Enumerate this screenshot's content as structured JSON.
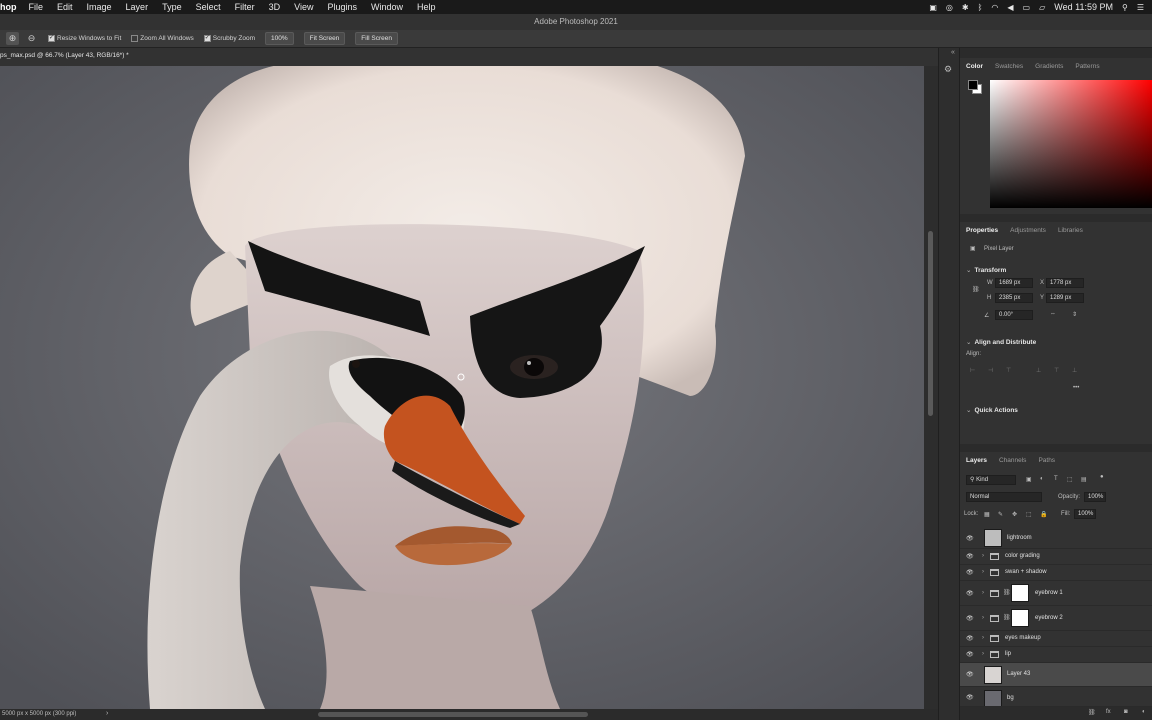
{
  "menubar": {
    "app": "hop",
    "items": [
      "File",
      "Edit",
      "Image",
      "Layer",
      "Type",
      "Select",
      "Filter",
      "3D",
      "View",
      "Plugins",
      "Window",
      "Help"
    ],
    "clock": "Wed 11:59 PM"
  },
  "titlebar": {
    "title": "Adobe Photoshop 2021"
  },
  "options": {
    "resize_windows": "Resize Windows to Fit",
    "zoom_all": "Zoom All Windows",
    "scrubby": "Scrubby Zoom",
    "zoom_pct": "100%",
    "fit_screen": "Fit Screen",
    "fill_screen": "Fill Screen"
  },
  "document": {
    "tab": "ps_max.psd @ 66.7% (Layer 43, RGB/16*) *"
  },
  "status": {
    "text": "5000 px x 5000 px (300 ppi)",
    "arrow": "›"
  },
  "color_panel": {
    "tabs": [
      "Color",
      "Swatches",
      "Gradients",
      "Patterns"
    ],
    "foreground": "#000000",
    "background": "#ffffff",
    "hue": "#ff0000"
  },
  "properties_panel": {
    "tabs": [
      "Properties",
      "Adjustments",
      "Libraries"
    ],
    "kind": "Pixel Layer",
    "transform": "Transform",
    "w_label": "W",
    "w": "1689 px",
    "x_label": "X",
    "x": "1778 px",
    "h_label": "H",
    "h": "2385 px",
    "y_label": "Y",
    "y": "1289 px",
    "angle": "0.00°",
    "align": "Align and Distribute",
    "align_sub": "Align:",
    "more": "•••",
    "quick": "Quick Actions"
  },
  "layers_panel": {
    "tabs": [
      "Layers",
      "Channels",
      "Paths"
    ],
    "kind": "Kind",
    "blend": "Normal",
    "opacity_label": "Opacity:",
    "opacity": "100%",
    "lock_label": "Lock:",
    "fill_label": "Fill:",
    "fill": "100%",
    "layers": [
      {
        "name": "lightroom"
      },
      {
        "name": "color grading"
      },
      {
        "name": "swan + shadow"
      },
      {
        "name": "eyebrow 1"
      },
      {
        "name": "eyebrow 2"
      },
      {
        "name": "eyes makeup"
      },
      {
        "name": "lip"
      },
      {
        "name": "Layer 43"
      },
      {
        "name": "bg"
      }
    ]
  }
}
